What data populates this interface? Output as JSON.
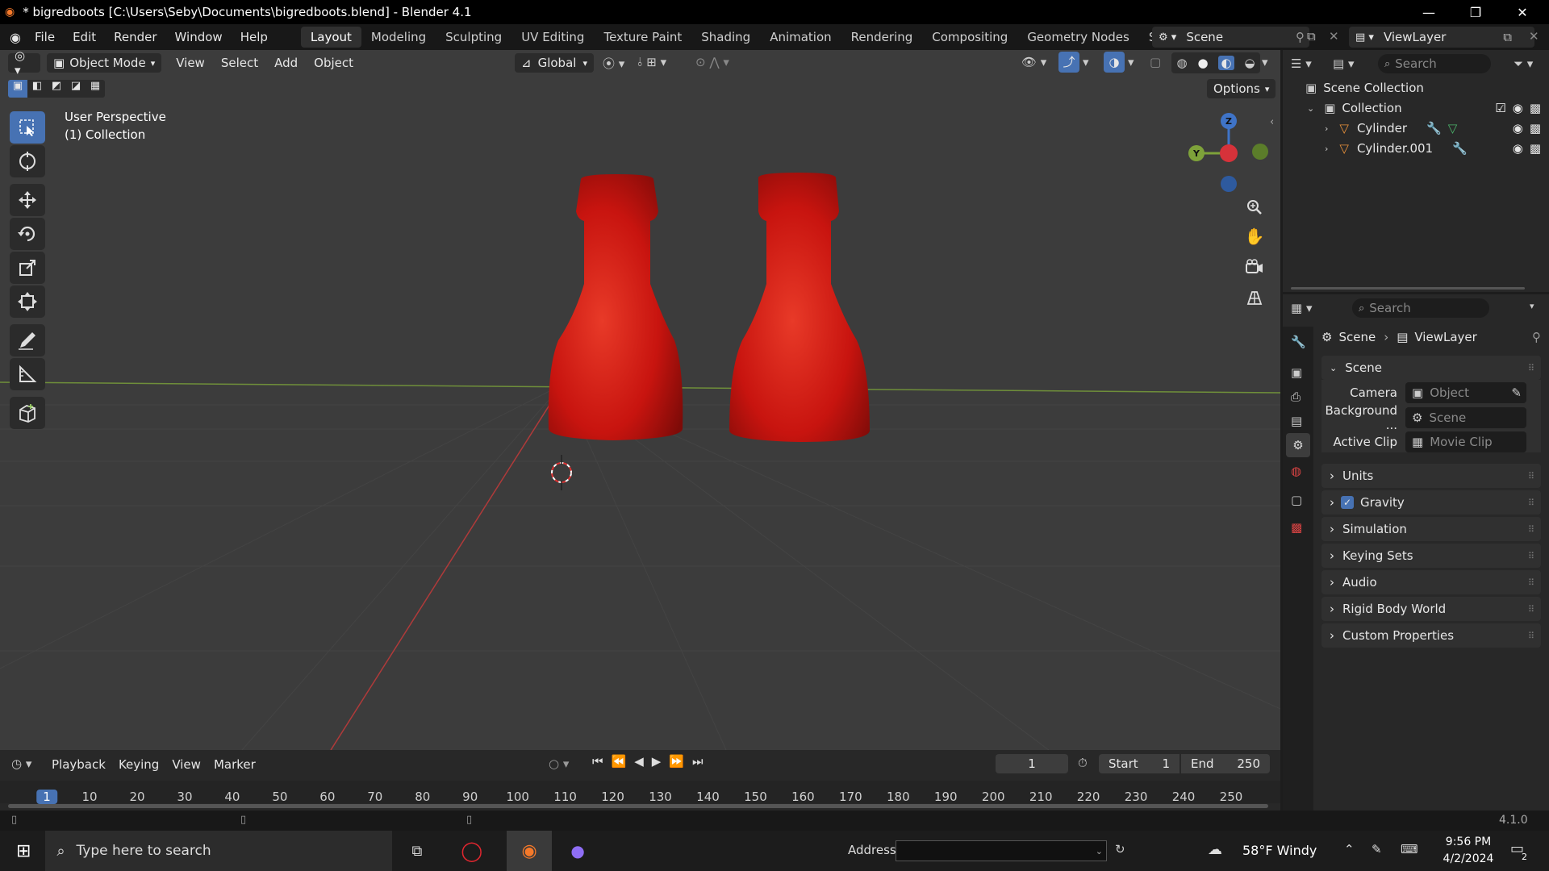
{
  "window": {
    "title": "* bigredboots [C:\\Users\\Seby\\Documents\\bigredboots.blend] - Blender 4.1"
  },
  "menu": [
    "File",
    "Edit",
    "Render",
    "Window",
    "Help"
  ],
  "workspaces": [
    "Layout",
    "Modeling",
    "Sculpting",
    "UV Editing",
    "Texture Paint",
    "Shading",
    "Animation",
    "Rendering",
    "Compositing",
    "Geometry Nodes",
    "Scripting"
  ],
  "active_workspace": "Layout",
  "scene_selector": {
    "scene": "Scene",
    "view_layer": "ViewLayer"
  },
  "viewport_header": {
    "mode": "Object Mode",
    "menus": [
      "View",
      "Select",
      "Add",
      "Object"
    ],
    "orientation": "Global",
    "options_label": "Options"
  },
  "viewport_overlay": {
    "line1": "User Perspective",
    "line2": "(1) Collection"
  },
  "gizmo_axes": {
    "z": "Z",
    "y": "Y"
  },
  "outliner": {
    "search_placeholder": "Search",
    "root": "Scene Collection",
    "collection": "Collection",
    "objects": [
      {
        "name": "Cylinder"
      },
      {
        "name": "Cylinder.001"
      }
    ]
  },
  "properties": {
    "search_placeholder": "Search",
    "breadcrumb": [
      "Scene",
      "ViewLayer"
    ],
    "scene_panel_title": "Scene",
    "fields": [
      {
        "label": "Camera",
        "value": "Object"
      },
      {
        "label": "Background ...",
        "value": "Scene"
      },
      {
        "label": "Active Clip",
        "value": "Movie Clip"
      }
    ],
    "panels": [
      "Units",
      "Gravity",
      "Simulation",
      "Keying Sets",
      "Audio",
      "Rigid Body World",
      "Custom Properties"
    ],
    "gravity_checked": true
  },
  "timeline": {
    "menus": [
      "Playback",
      "Keying",
      "View",
      "Marker"
    ],
    "current_frame": "1",
    "start_label": "Start",
    "start": "1",
    "end_label": "End",
    "end": "250",
    "ruler": [
      "1",
      "10",
      "20",
      "30",
      "40",
      "50",
      "60",
      "70",
      "80",
      "90",
      "100",
      "110",
      "120",
      "130",
      "140",
      "150",
      "160",
      "170",
      "180",
      "190",
      "200",
      "210",
      "220",
      "230",
      "240",
      "250"
    ]
  },
  "status": {
    "version": "4.1.0"
  },
  "taskbar": {
    "search_placeholder": "Type here to search",
    "address_label": "Address",
    "weather": "58°F  Windy",
    "time": "9:56 PM",
    "date": "4/2/2024",
    "notif_count": "2"
  },
  "colors": {
    "accent": "#4772b3",
    "boot_red": "#d41c17",
    "viewport_bg": "#3c3c3c"
  }
}
